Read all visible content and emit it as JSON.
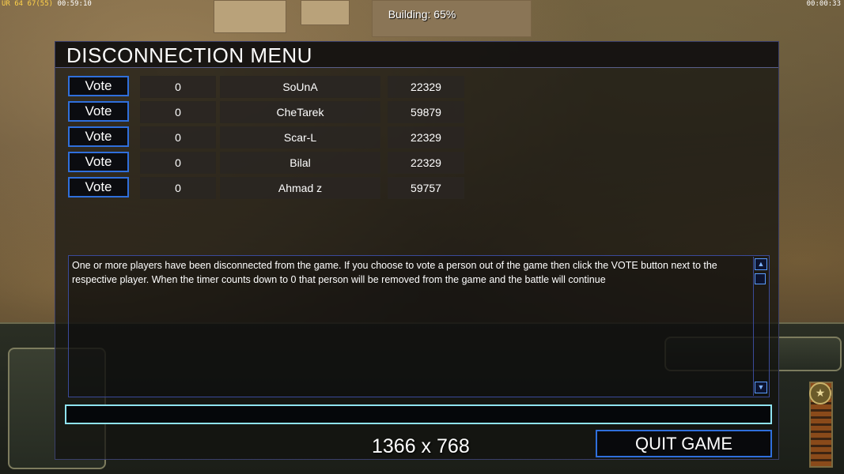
{
  "hud": {
    "top_left_prefix": "UR",
    "top_left_vals": "64 67(55)",
    "top_left_time": "00:59:10",
    "top_right_time": "00:00:33",
    "building_status": "Building: 65%"
  },
  "menu": {
    "title": "DISCONNECTION MENU",
    "vote_label": "Vote",
    "players": [
      {
        "count": "0",
        "name": "SoUnA",
        "id": "22329"
      },
      {
        "count": "0",
        "name": "CheTarek",
        "id": "59879"
      },
      {
        "count": "0",
        "name": "Scar-L",
        "id": "22329"
      },
      {
        "count": "0",
        "name": "Bilal",
        "id": "22329"
      },
      {
        "count": "0",
        "name": "Ahmad z",
        "id": "59757"
      }
    ],
    "message": "One or more players have been disconnected from the game. If you choose to vote a person out of the game then click the VOTE button next to the respective player. When the timer counts down to 0 that person will be removed from the game and the battle will continue",
    "chat_value": "",
    "resolution": "1366 x 768",
    "quit_label": "QUIT GAME"
  },
  "colors": {
    "button_border": "#2f6fdc",
    "chat_border": "#8fe3f0",
    "panel_border": "#3a3f6a"
  },
  "icons": {
    "scroll_up": "triangle-up",
    "scroll_down": "triangle-down",
    "rank": "star"
  }
}
